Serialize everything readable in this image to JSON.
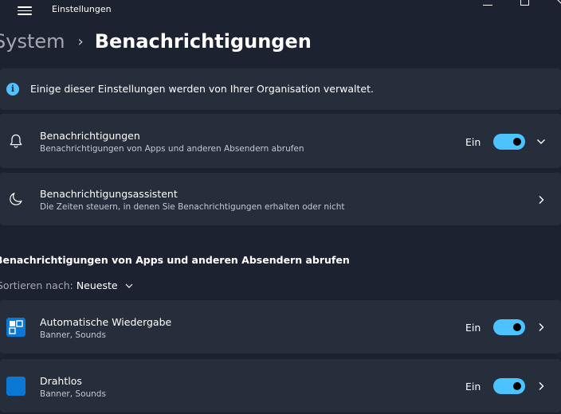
{
  "window": {
    "title": "Einstellungen"
  },
  "breadcrumb": {
    "parent": "System",
    "separator": "›",
    "current": "Benachrichtigungen"
  },
  "info": {
    "text": "Einige dieser Einstellungen werden von Ihrer Organisation verwaltet.",
    "icon": "info-icon"
  },
  "settings": [
    {
      "title": "Benachrichtigungen",
      "subtitle": "Benachrichtigungen von Apps und anderen Absendern abrufen",
      "toggle_label": "Ein",
      "toggle_on": true,
      "icon": "bell-icon"
    },
    {
      "title": "Benachrichtigungsassistent",
      "subtitle": "Die Zeiten steuern, in denen Sie Benachrichtigungen erhalten oder nicht",
      "icon": "moon-icon"
    }
  ],
  "apps_section": {
    "title": "Benachrichtigungen von Apps und anderen Absendern abrufen",
    "sort_label": "Sortieren nach:",
    "sort_value": "Neueste"
  },
  "apps": [
    {
      "name": "Automatische Wiedergabe",
      "detail": "Banner, Sounds",
      "toggle_label": "Ein",
      "toggle_on": true,
      "icon": "autoplay-icon"
    },
    {
      "name": "Drahtlos",
      "detail": "Banner, Sounds",
      "toggle_label": "Ein",
      "toggle_on": true,
      "icon": "wireless-icon"
    }
  ],
  "colors": {
    "accent": "#4cc2ff",
    "background": "#1c2230",
    "card": "#262d3b",
    "muted_text": "#a3a8b2",
    "app_icon_blue": "#0a78d4"
  }
}
